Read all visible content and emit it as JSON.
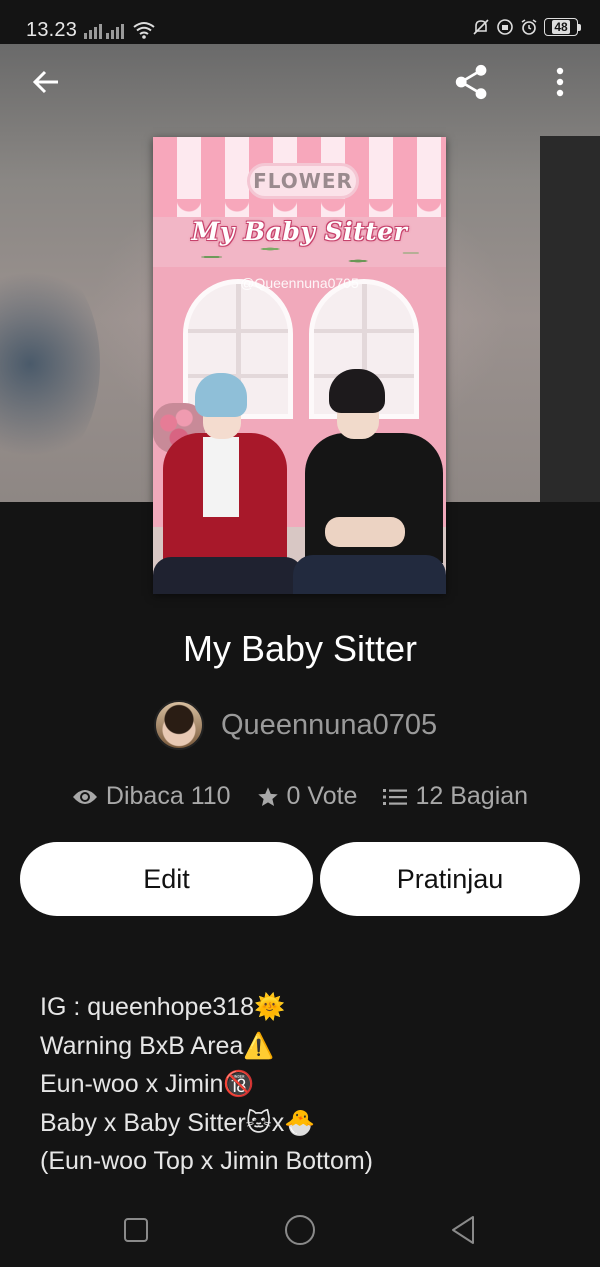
{
  "status_bar": {
    "time": "13.23",
    "battery": "48"
  },
  "toolbar": {
    "back_icon": "arrow-left-icon",
    "share_icon": "share-icon",
    "more_icon": "more-vertical-icon"
  },
  "cover": {
    "sign_text": "FLOWER",
    "title_art": "My Baby Sitter",
    "handle": "@Queennuna0705"
  },
  "story": {
    "title": "My Baby Sitter",
    "author": "Queennuna0705",
    "stats": {
      "reads": "Dibaca 110",
      "votes": "0 Vote",
      "parts": "12 Bagian"
    }
  },
  "actions": {
    "edit_label": "Edit",
    "preview_label": "Pratinjau"
  },
  "description": [
    "IG : queenhope318🌞",
    "Warning BxB Area⚠️",
    "Eun-woo x Jimin🔞",
    "Baby x Baby Sitter🐱x🐣",
    "(Eun-woo Top x Jimin Bottom)"
  ],
  "colors": {
    "background": "#141414",
    "button_bg": "#ffffff",
    "muted_text": "#a8a8a8"
  }
}
